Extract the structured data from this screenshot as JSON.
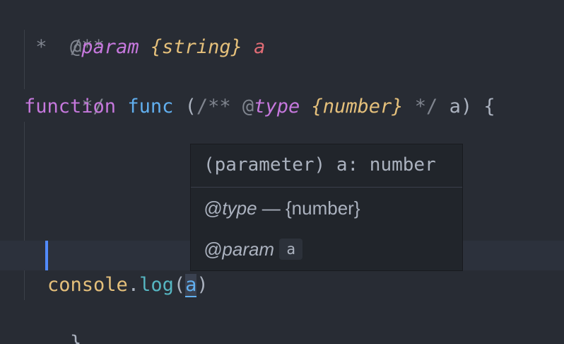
{
  "code": {
    "line1": {
      "text": "/**"
    },
    "line2": {
      "star": " *  ",
      "at": "@",
      "tag": "param",
      "type": "{string}",
      "name": "a"
    },
    "line3": {
      "text": " */"
    },
    "line4": {
      "keyword": "function",
      "name": "func",
      "open_paren": "(",
      "comment_open": "/**",
      "at": "@",
      "tag": "type",
      "type": "{number}",
      "comment_close": "*/",
      "param": "a",
      "close": ") {"
    },
    "line9": {
      "object": "console",
      "dot": ".",
      "method": "log",
      "open": "(",
      "arg": "a",
      "close": ")"
    },
    "line10": {
      "text": "}"
    }
  },
  "hover": {
    "signature": "(parameter) a: number",
    "type_tag": "@type",
    "type_text": " — {number}",
    "param_tag": "@param",
    "param_name": "a"
  },
  "colors": {
    "background": "#282c34",
    "keyword": "#c678dd",
    "function": "#61afef",
    "type": "#e5c07b",
    "param": "#e06c75",
    "cursor": "#528bff"
  }
}
